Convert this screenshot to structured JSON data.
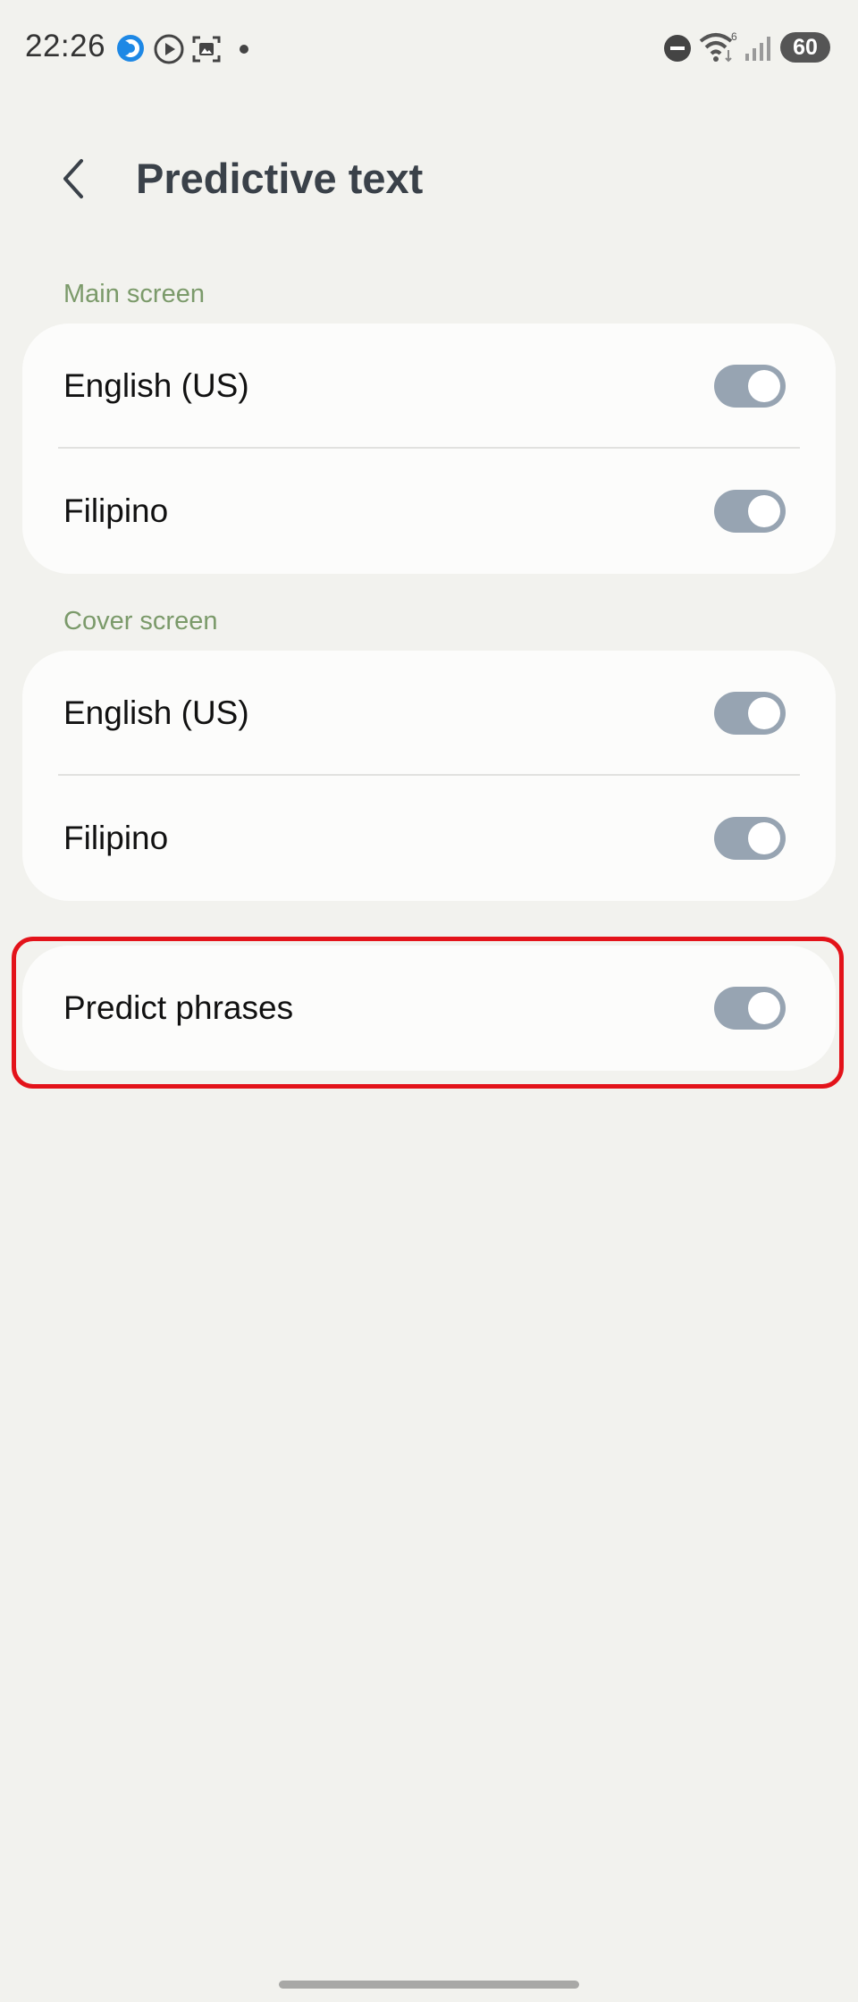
{
  "status_bar": {
    "time": "22:26",
    "battery": "60",
    "left_icons": [
      "app-notification-icon",
      "play-icon",
      "screenshot-icon",
      "dot-icon"
    ],
    "right_icons": [
      "do-not-disturb-icon",
      "wifi-icon",
      "signal-icon",
      "battery-icon"
    ]
  },
  "header": {
    "title": "Predictive text"
  },
  "main_screen": {
    "label": "Main screen",
    "items": [
      {
        "label": "English (US)",
        "enabled": true
      },
      {
        "label": "Filipino",
        "enabled": true
      }
    ]
  },
  "cover_screen": {
    "label": "Cover screen",
    "items": [
      {
        "label": "English (US)",
        "enabled": true
      },
      {
        "label": "Filipino",
        "enabled": true
      }
    ]
  },
  "predict_phrases": {
    "label": "Predict phrases",
    "enabled": true
  },
  "colors": {
    "background": "#f2f2ee",
    "card": "#fcfcfb",
    "section_label": "#7b9a6a",
    "toggle_on": "#97a4b2",
    "highlight": "#e3131a"
  }
}
